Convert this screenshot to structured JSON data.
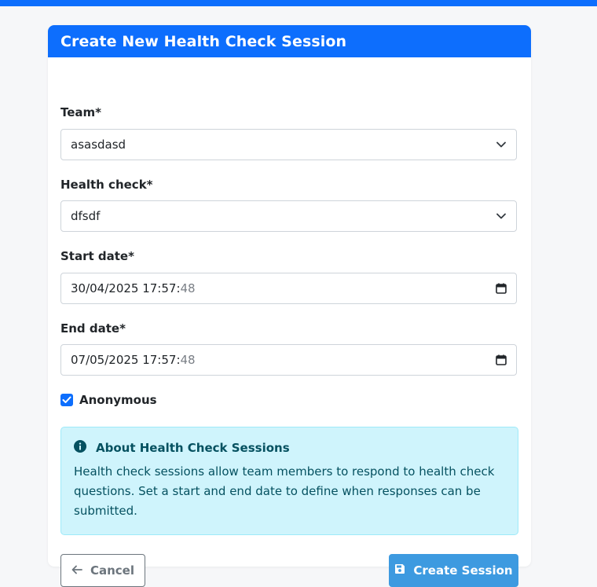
{
  "form": {
    "title": "Create New Health Check Session",
    "team": {
      "label": "Team*",
      "value": "asasdasd"
    },
    "health_check": {
      "label": "Health check*",
      "value": "dfsdf"
    },
    "start_date": {
      "label": "Start date*",
      "value": "30/04/2025 17:57:",
      "seconds": "48"
    },
    "end_date": {
      "label": "End date*",
      "value": "07/05/2025 17:57:",
      "seconds": "48"
    },
    "anonymous": {
      "label": "Anonymous",
      "checked": true
    }
  },
  "info": {
    "title": "About Health Check Sessions",
    "text": "Health check sessions allow team members to respond to health check questions. Set a start and end date to define when responses can be submitted."
  },
  "actions": {
    "cancel_label": "Cancel",
    "create_label": "Create Session"
  },
  "colors": {
    "primary": "#0d6efd",
    "create_button": "#3d9ae0",
    "info_bg": "#cff4fc",
    "info_text": "#055160"
  },
  "icons": {
    "select": "chevron-down-icon",
    "date": "calendar-icon",
    "info": "info-circle-icon",
    "cancel": "arrow-left-icon",
    "create": "save-icon"
  }
}
